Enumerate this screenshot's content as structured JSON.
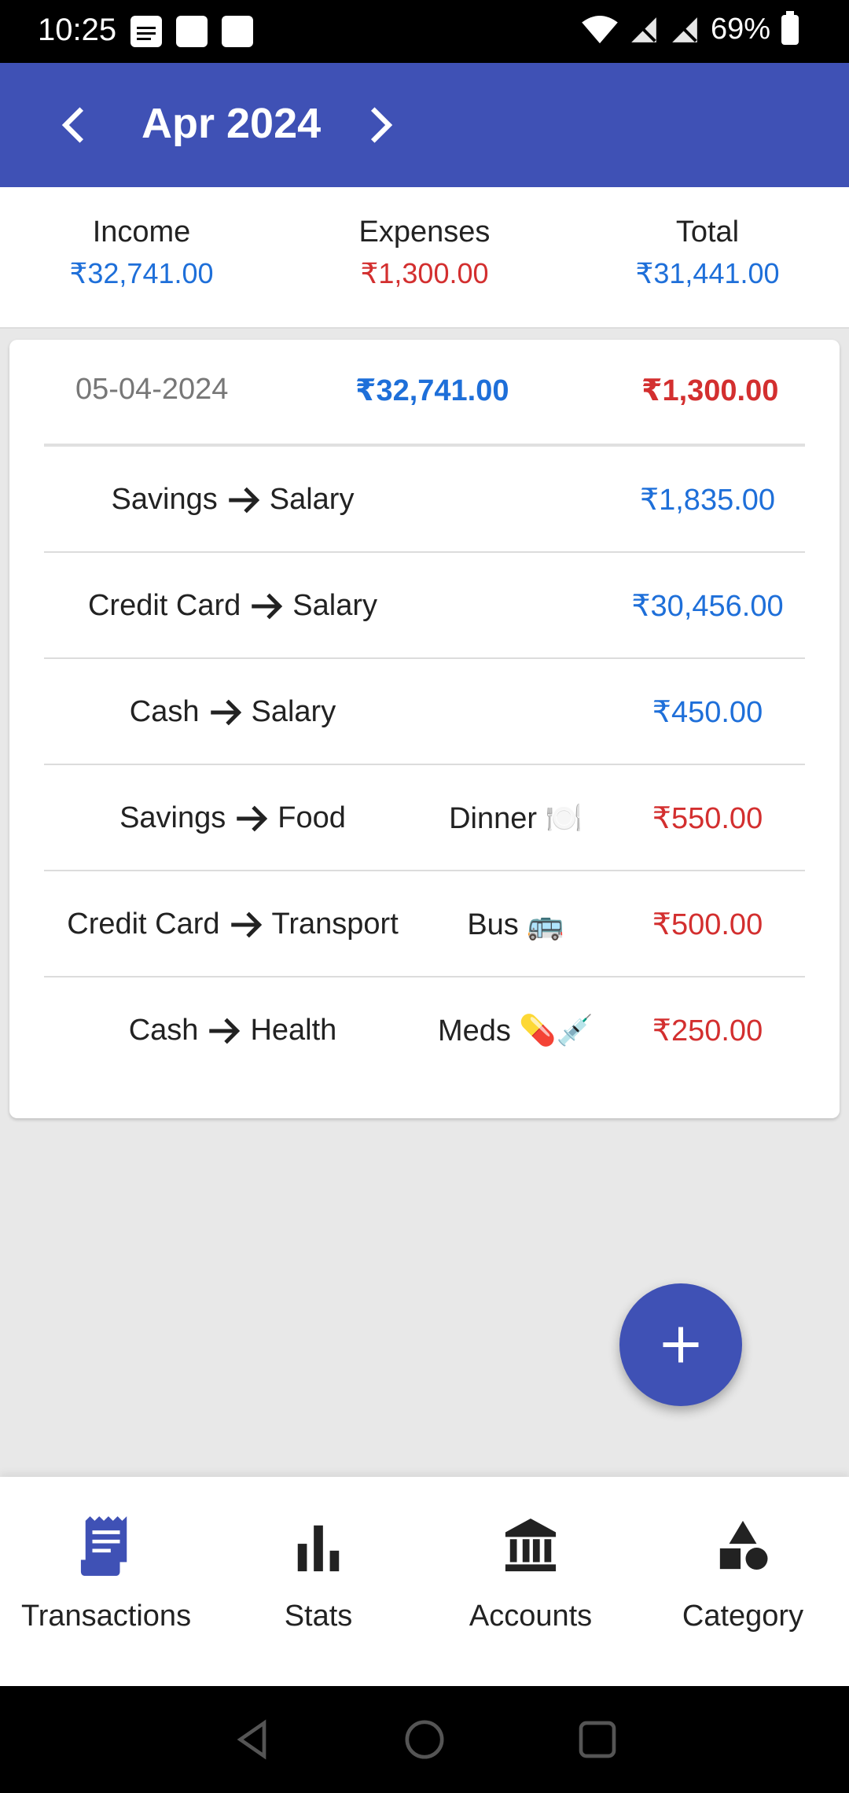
{
  "status_bar": {
    "time": "10:25",
    "battery": "69%"
  },
  "header": {
    "month": "Apr 2024"
  },
  "summary": {
    "income_label": "Income",
    "income_value": "₹32,741.00",
    "expenses_label": "Expenses",
    "expenses_value": "₹1,300.00",
    "total_label": "Total",
    "total_value": "₹31,441.00"
  },
  "day": {
    "date": "05-04-2024",
    "income": "₹32,741.00",
    "expense": "₹1,300.00",
    "transactions": [
      {
        "from": "Savings",
        "to": "Salary",
        "note": "",
        "amount": "₹1,835.00",
        "type": "income"
      },
      {
        "from": "Credit Card",
        "to": "Salary",
        "note": "",
        "amount": "₹30,456.00",
        "type": "income"
      },
      {
        "from": "Cash",
        "to": "Salary",
        "note": "",
        "amount": "₹450.00",
        "type": "income"
      },
      {
        "from": "Savings",
        "to": "Food",
        "note": "Dinner 🍽️",
        "amount": "₹550.00",
        "type": "expense"
      },
      {
        "from": "Credit Card",
        "to": "Transport",
        "note": "Bus 🚌",
        "amount": "₹500.00",
        "type": "expense"
      },
      {
        "from": "Cash",
        "to": "Health",
        "note": "Meds 💊💉",
        "amount": "₹250.00",
        "type": "expense"
      }
    ]
  },
  "bottom_nav": [
    {
      "label": "Transactions",
      "icon": "receipt-icon",
      "active": true
    },
    {
      "label": "Stats",
      "icon": "bar-chart-icon",
      "active": false
    },
    {
      "label": "Accounts",
      "icon": "bank-icon",
      "active": false
    },
    {
      "label": "Category",
      "icon": "category-icon",
      "active": false
    }
  ],
  "colors": {
    "primary": "#3f51b5",
    "income": "#1e6fd9",
    "expense": "#d32f2f"
  }
}
